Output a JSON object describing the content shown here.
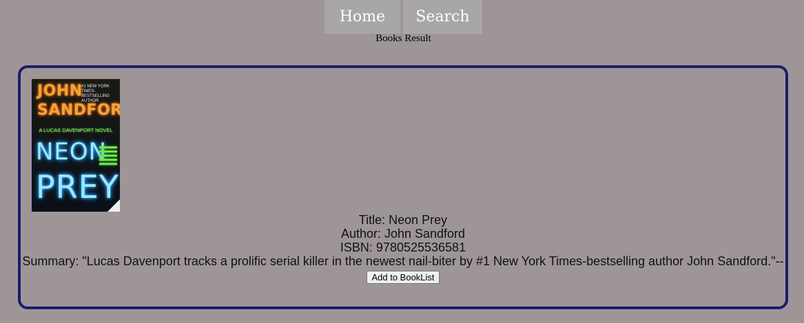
{
  "nav": {
    "home_label": "Home",
    "search_label": "Search"
  },
  "page": {
    "heading": "Books Result"
  },
  "book": {
    "cover": {
      "author_line1": "JOHN",
      "author_line2": "SANDFORD",
      "tagline": "#1 NEW YORK TIMES-BESTSELLING AUTHOR",
      "series": "A LUCAS DAVENPORT NOVEL",
      "title_line1": "NEON",
      "title_line2": "PREY"
    },
    "title_line": "Title: Neon Prey",
    "author_line": "Author: John Sandford",
    "isbn_line": "ISBN: 9780525536581",
    "summary_line": "Summary: \"Lucas Davenport tracks a prolific serial killer in the newest nail-biter by #1 New York Times-bestselling author John Sandford.\"--",
    "add_button_label": "Add to BookList"
  }
}
